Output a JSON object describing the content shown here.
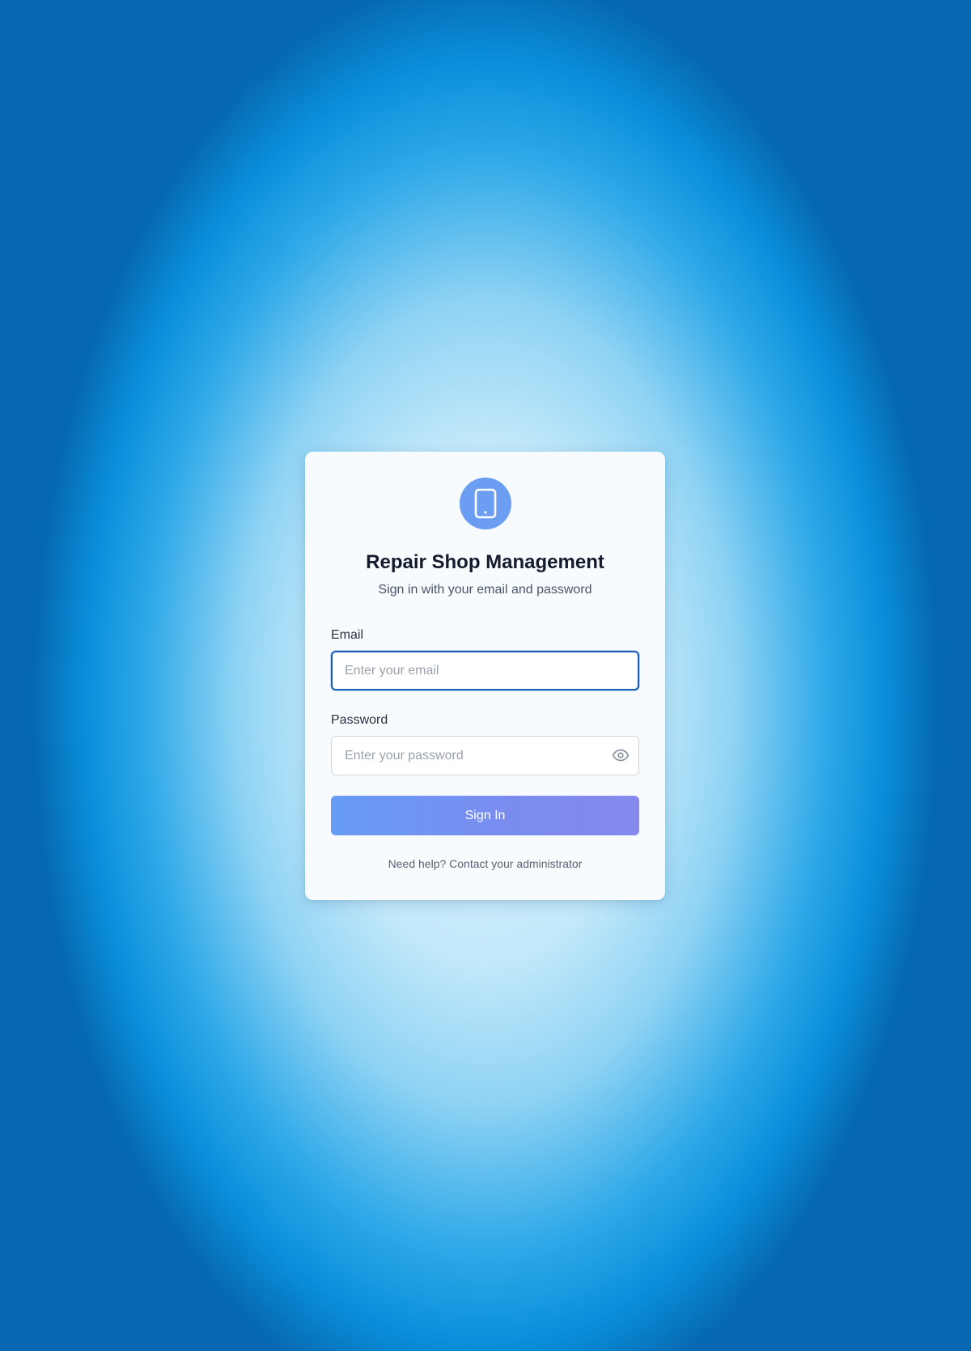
{
  "app": {
    "title": "Repair Shop Management",
    "subtitle": "Sign in with your email and password",
    "logo_icon": "tablet-icon",
    "accent_color": "#6b9df2"
  },
  "form": {
    "email": {
      "label": "Email",
      "placeholder": "Enter your email",
      "value": ""
    },
    "password": {
      "label": "Password",
      "placeholder": "Enter your password",
      "value": "",
      "toggle_icon": "eye-icon"
    },
    "submit_label": "Sign In"
  },
  "footer": {
    "help_text": "Need help? Contact your administrator"
  }
}
